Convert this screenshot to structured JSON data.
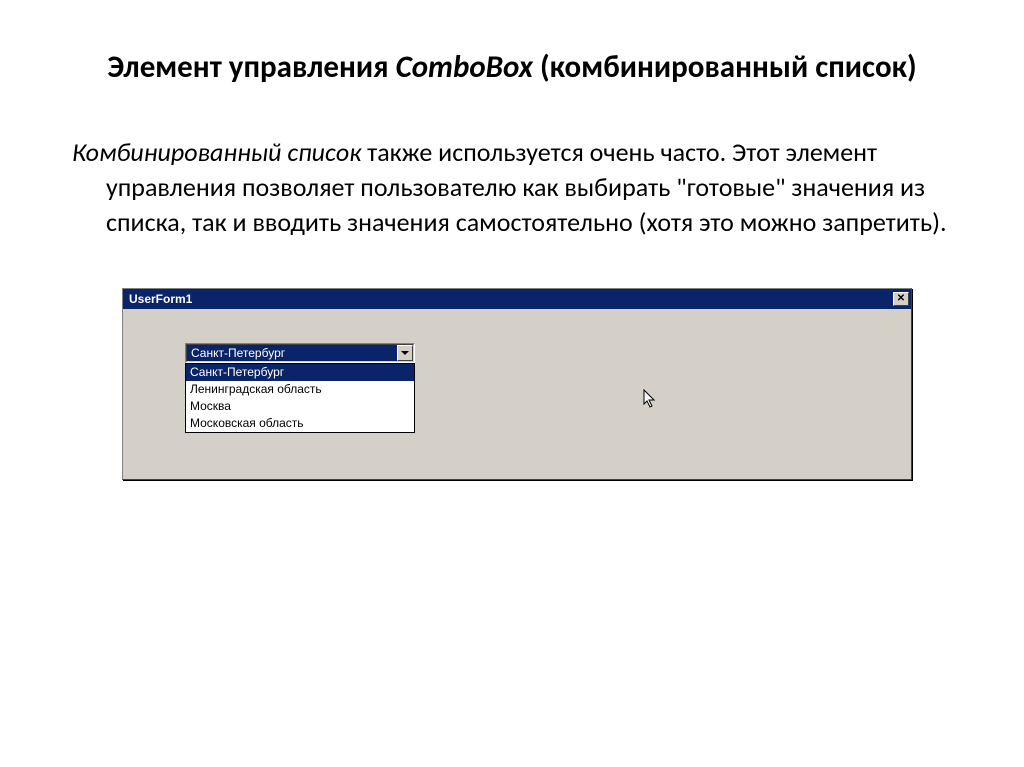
{
  "title": {
    "part1": "Элемент управления ",
    "italic": "ComboBox",
    "part2": " (комбинированный список)"
  },
  "body": {
    "italic": "Комбинированный список",
    "rest": " также используется очень часто. Этот элемент управления позволяет пользователю как выбирать \"готовые\" значения из списка, так и вводить значения самостоятельно (хотя это можно запретить)."
  },
  "window": {
    "title": "UserForm1",
    "close": "✕"
  },
  "combobox": {
    "selected": "Санкт-Петербург",
    "items": [
      "Санкт-Петербург",
      "Ленинградская область",
      "Москва",
      "Московская область"
    ]
  }
}
